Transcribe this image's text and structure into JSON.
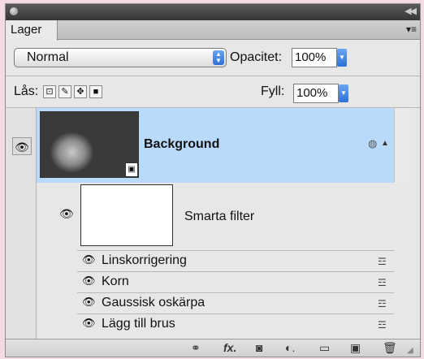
{
  "panel": {
    "tab_label": "Lager",
    "blend_mode": "Normal",
    "opacity_label": "Opacitet:",
    "opacity_value": "100%",
    "lock_label": "Lås:",
    "fill_label": "Fyll:",
    "fill_value": "100%"
  },
  "layers": [
    {
      "name": "Background",
      "visible": true,
      "selected": true,
      "type": "smart-object"
    }
  ],
  "smart_filters": {
    "label": "Smarta filter",
    "items": [
      {
        "name": "Linskorrigering"
      },
      {
        "name": "Korn"
      },
      {
        "name": "Gaussisk oskärpa"
      },
      {
        "name": "Lägg till brus"
      }
    ]
  },
  "colors": {
    "selection": "#b9dafb",
    "panel_bg": "#e7e7e7",
    "accent_blue": "#2c6fd8"
  },
  "icons": {
    "footer": [
      "link-icon",
      "fx-icon",
      "mask-icon",
      "adjustment-icon",
      "folder-icon",
      "new-layer-icon",
      "trash-icon"
    ]
  }
}
